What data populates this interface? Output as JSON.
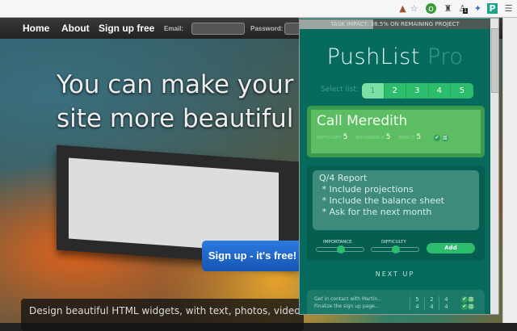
{
  "browser": {
    "toolbar_icons": [
      "arrow-icon",
      "star-icon",
      "green-extension-icon",
      "pin-icon",
      "badge-extension-icon",
      "puzzle-icon",
      "pushlist-icon",
      "menu-icon"
    ],
    "badge": "1"
  },
  "site": {
    "nav": {
      "home": "Home",
      "about": "About",
      "signup": "Sign up free",
      "email_label": "Email:",
      "password_label": "Password:"
    },
    "hero": {
      "line1": "You can make your",
      "line2": "site more beautiful"
    },
    "signup_button": "Sign up - it's free!",
    "description": "Design beautiful HTML widgets, with text, photos, videos and s"
  },
  "popup": {
    "impact_text": "TASK IMPACT: 38.5% ON REMAINING PROJECT",
    "impact_percent": 38.5,
    "title": "PushList",
    "title_suffix": "Pro",
    "select_label": "Select list:",
    "lists": [
      "1",
      "2",
      "3",
      "4",
      "5"
    ],
    "active_list": "1",
    "current_task": {
      "title": "Call Meredith",
      "difficulty_label": "DIFFICULTY",
      "difficulty": "5",
      "importance_label": "IMPORTANCE",
      "importance": "5",
      "impact_label": "IMPACT",
      "impact": "5"
    },
    "form": {
      "note": "Q/4 Report\n * Include projections\n * Include the balance sheet\n * Ask for the next month",
      "importance_label": "IMPORTANCE",
      "importance_value": 0.5,
      "difficulty_label": "DIFFICULTY",
      "difficulty_value": 0.5,
      "add_label": "Add"
    },
    "next_up_label": "NEXT UP",
    "next": [
      {
        "name": "Get in contact with Martin...",
        "a": "5",
        "b": "2",
        "c": "4"
      },
      {
        "name": "Finalize the sign up page...",
        "a": "4",
        "b": "4",
        "c": "4"
      }
    ]
  },
  "colors": {
    "popup_bg": "#066b5c",
    "accent": "#2bbd6c",
    "signup": "#1f6cd0"
  }
}
